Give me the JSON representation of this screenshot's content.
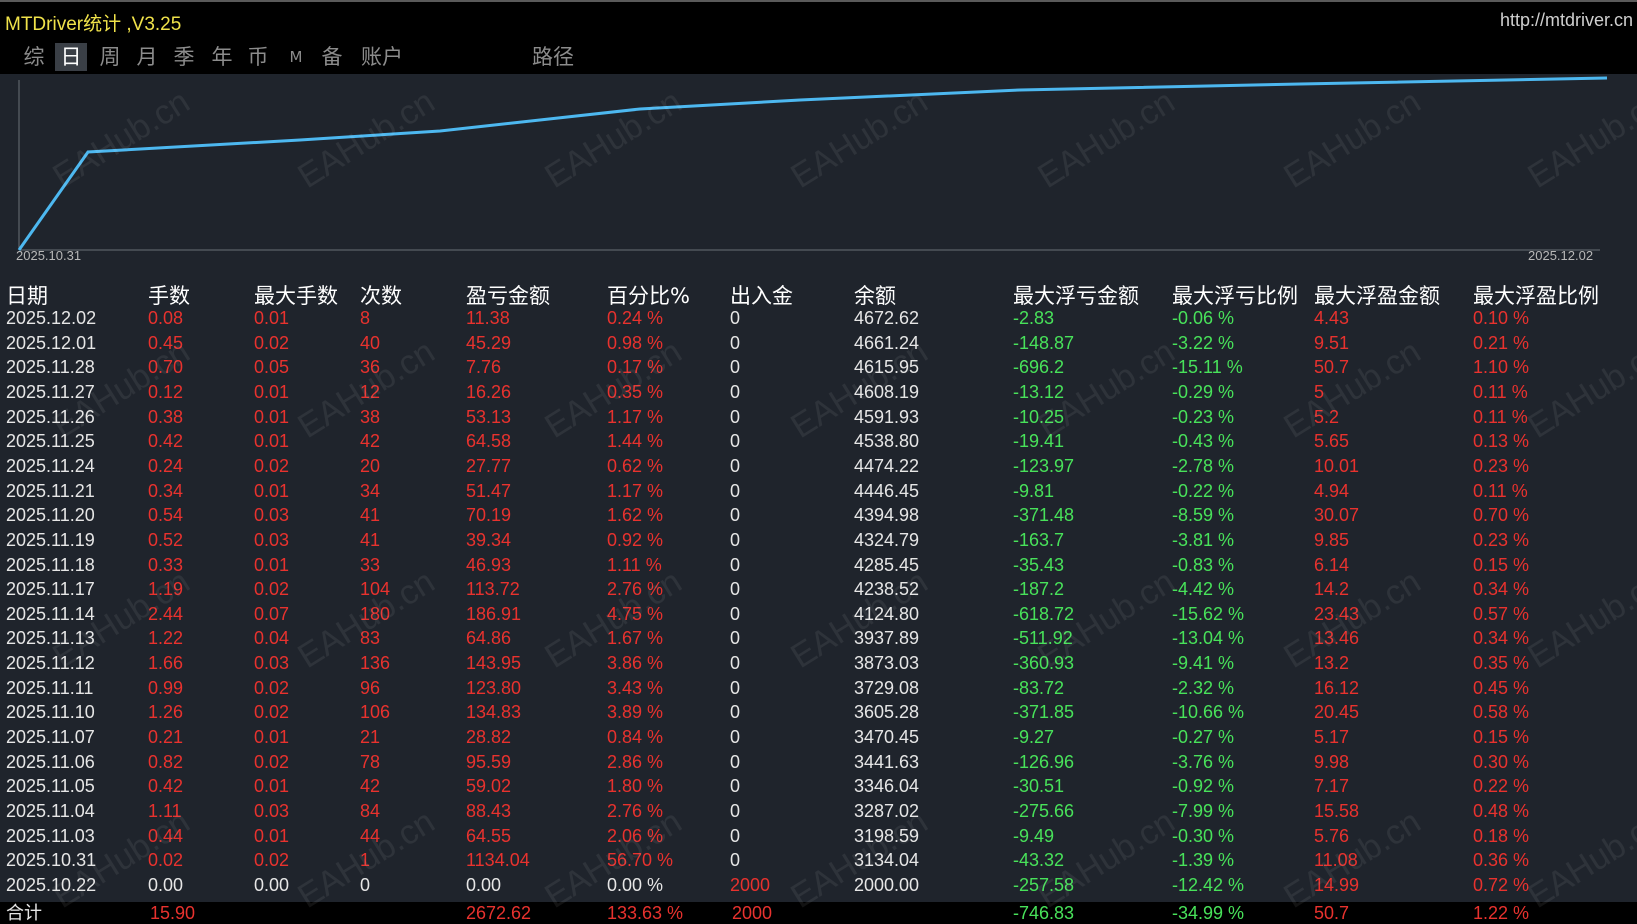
{
  "window": {
    "title": "MTDriver统计 ,V3.25",
    "url": "http://mtdriver.cn"
  },
  "tabs": [
    {
      "label": "综",
      "active": false
    },
    {
      "label": "日",
      "active": true
    },
    {
      "label": "周",
      "active": false
    },
    {
      "label": "月",
      "active": false
    },
    {
      "label": "季",
      "active": false
    },
    {
      "label": "年",
      "active": false
    },
    {
      "label": "币",
      "active": false
    },
    {
      "label": "M",
      "active": false
    },
    {
      "label": "备",
      "active": false
    },
    {
      "label": "账户",
      "active": false
    },
    {
      "label": "路径",
      "active": false
    }
  ],
  "chart": {
    "start_label": "2025.10.31",
    "end_label": "2025.12.02",
    "line_color": "#4db8f0"
  },
  "watermark": "EAHub.cn",
  "columns": [
    "日期",
    "手数",
    "最大手数",
    "次数",
    "盈亏金额",
    "百分比%",
    "出入金",
    "余额",
    "最大浮亏金额",
    "最大浮亏比例",
    "最大浮盈金额",
    "最大浮盈比例"
  ],
  "rows": [
    [
      "2025.12.02",
      "0.08",
      "0.01",
      "8",
      "11.38",
      "0.24 %",
      "0",
      "4672.62",
      "-2.83",
      "-0.06 %",
      "4.43",
      "0.10 %"
    ],
    [
      "2025.12.01",
      "0.45",
      "0.02",
      "40",
      "45.29",
      "0.98 %",
      "0",
      "4661.24",
      "-148.87",
      "-3.22 %",
      "9.51",
      "0.21 %"
    ],
    [
      "2025.11.28",
      "0.70",
      "0.05",
      "36",
      "7.76",
      "0.17 %",
      "0",
      "4615.95",
      "-696.2",
      "-15.11 %",
      "50.7",
      "1.10 %"
    ],
    [
      "2025.11.27",
      "0.12",
      "0.01",
      "12",
      "16.26",
      "0.35 %",
      "0",
      "4608.19",
      "-13.12",
      "-0.29 %",
      "5",
      "0.11 %"
    ],
    [
      "2025.11.26",
      "0.38",
      "0.01",
      "38",
      "53.13",
      "1.17 %",
      "0",
      "4591.93",
      "-10.25",
      "-0.23 %",
      "5.2",
      "0.11 %"
    ],
    [
      "2025.11.25",
      "0.42",
      "0.01",
      "42",
      "64.58",
      "1.44 %",
      "0",
      "4538.80",
      "-19.41",
      "-0.43 %",
      "5.65",
      "0.13 %"
    ],
    [
      "2025.11.24",
      "0.24",
      "0.02",
      "20",
      "27.77",
      "0.62 %",
      "0",
      "4474.22",
      "-123.97",
      "-2.78 %",
      "10.01",
      "0.23 %"
    ],
    [
      "2025.11.21",
      "0.34",
      "0.01",
      "34",
      "51.47",
      "1.17 %",
      "0",
      "4446.45",
      "-9.81",
      "-0.22 %",
      "4.94",
      "0.11 %"
    ],
    [
      "2025.11.20",
      "0.54",
      "0.03",
      "41",
      "70.19",
      "1.62 %",
      "0",
      "4394.98",
      "-371.48",
      "-8.59 %",
      "30.07",
      "0.70 %"
    ],
    [
      "2025.11.19",
      "0.52",
      "0.03",
      "41",
      "39.34",
      "0.92 %",
      "0",
      "4324.79",
      "-163.7",
      "-3.81 %",
      "9.85",
      "0.23 %"
    ],
    [
      "2025.11.18",
      "0.33",
      "0.01",
      "33",
      "46.93",
      "1.11 %",
      "0",
      "4285.45",
      "-35.43",
      "-0.83 %",
      "6.14",
      "0.15 %"
    ],
    [
      "2025.11.17",
      "1.19",
      "0.02",
      "104",
      "113.72",
      "2.76 %",
      "0",
      "4238.52",
      "-187.2",
      "-4.42 %",
      "14.2",
      "0.34 %"
    ],
    [
      "2025.11.14",
      "2.44",
      "0.07",
      "180",
      "186.91",
      "4.75 %",
      "0",
      "4124.80",
      "-618.72",
      "-15.62 %",
      "23.43",
      "0.57 %"
    ],
    [
      "2025.11.13",
      "1.22",
      "0.04",
      "83",
      "64.86",
      "1.67 %",
      "0",
      "3937.89",
      "-511.92",
      "-13.04 %",
      "13.46",
      "0.34 %"
    ],
    [
      "2025.11.12",
      "1.66",
      "0.03",
      "136",
      "143.95",
      "3.86 %",
      "0",
      "3873.03",
      "-360.93",
      "-9.41 %",
      "13.2",
      "0.35 %"
    ],
    [
      "2025.11.11",
      "0.99",
      "0.02",
      "96",
      "123.80",
      "3.43 %",
      "0",
      "3729.08",
      "-83.72",
      "-2.32 %",
      "16.12",
      "0.45 %"
    ],
    [
      "2025.11.10",
      "1.26",
      "0.02",
      "106",
      "134.83",
      "3.89 %",
      "0",
      "3605.28",
      "-371.85",
      "-10.66 %",
      "20.45",
      "0.58 %"
    ],
    [
      "2025.11.07",
      "0.21",
      "0.01",
      "21",
      "28.82",
      "0.84 %",
      "0",
      "3470.45",
      "-9.27",
      "-0.27 %",
      "5.17",
      "0.15 %"
    ],
    [
      "2025.11.06",
      "0.82",
      "0.02",
      "78",
      "95.59",
      "2.86 %",
      "0",
      "3441.63",
      "-126.96",
      "-3.76 %",
      "9.98",
      "0.30 %"
    ],
    [
      "2025.11.05",
      "0.42",
      "0.01",
      "42",
      "59.02",
      "1.80 %",
      "0",
      "3346.04",
      "-30.51",
      "-0.92 %",
      "7.17",
      "0.22 %"
    ],
    [
      "2025.11.04",
      "1.11",
      "0.03",
      "84",
      "88.43",
      "2.76 %",
      "0",
      "3287.02",
      "-275.66",
      "-7.99 %",
      "15.58",
      "0.48 %"
    ],
    [
      "2025.11.03",
      "0.44",
      "0.01",
      "44",
      "64.55",
      "2.06 %",
      "0",
      "3198.59",
      "-9.49",
      "-0.30 %",
      "5.76",
      "0.18 %"
    ],
    [
      "2025.10.31",
      "0.02",
      "0.02",
      "1",
      "1134.04",
      "56.70 %",
      "0",
      "3134.04",
      "-43.32",
      "-1.39 %",
      "11.08",
      "0.36 %"
    ],
    [
      "2025.10.22",
      "0.00",
      "0.00",
      "0",
      "0.00",
      "0.00 %",
      "2000",
      "2000.00",
      "-257.58",
      "-12.42 %",
      "14.99",
      "0.72 %"
    ]
  ],
  "total": {
    "label": "合计",
    "lots": "15.90",
    "profit": "2672.62",
    "percent": "133.63 %",
    "deposit": "2000",
    "max_float_loss": "-746.83",
    "max_float_loss_pct": "-34.99 %",
    "max_float_profit": "50.7",
    "max_float_profit_pct": "1.22 %"
  }
}
